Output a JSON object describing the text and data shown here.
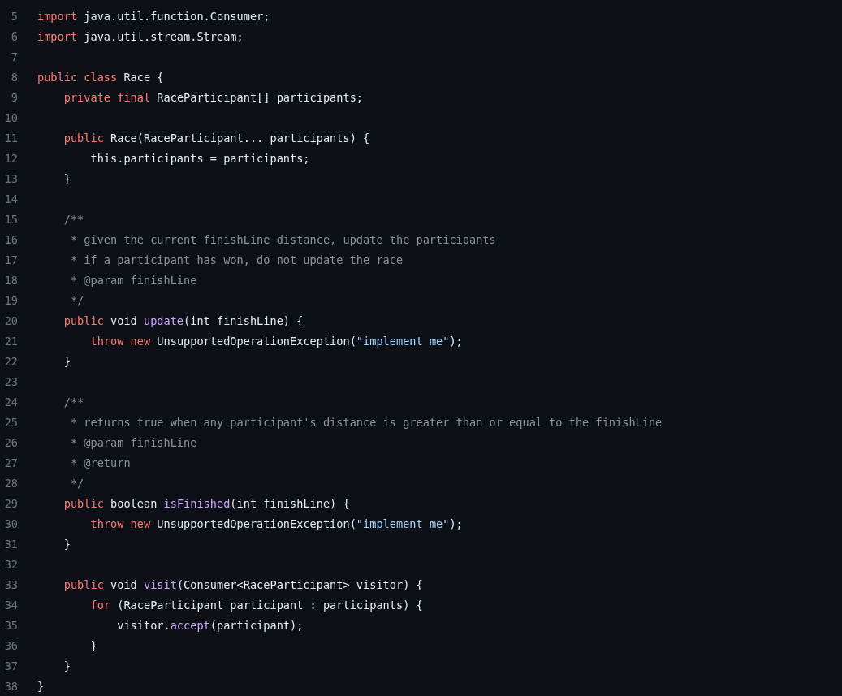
{
  "code_lines": [
    {
      "number": "5",
      "tokens": [
        {
          "kind": "keyword",
          "text": "import"
        },
        {
          "kind": "plain",
          "text": " java.util.function.Consumer;"
        }
      ]
    },
    {
      "number": "6",
      "tokens": [
        {
          "kind": "keyword",
          "text": "import"
        },
        {
          "kind": "plain",
          "text": " java.util.stream.Stream;"
        }
      ]
    },
    {
      "number": "7"
    },
    {
      "number": "8",
      "tokens": [
        {
          "kind": "keyword",
          "text": "public class"
        },
        {
          "kind": "plain",
          "text": " Race {"
        }
      ]
    },
    {
      "number": "9",
      "tokens": [
        {
          "kind": "keyword",
          "text": "    private final"
        },
        {
          "kind": "plain",
          "text": " RaceParticipant[] participants;"
        }
      ]
    },
    {
      "number": "10"
    },
    {
      "number": "11",
      "tokens": [
        {
          "kind": "keyword",
          "text": "    public"
        },
        {
          "kind": "plain",
          "text": " Race(RaceParticipant... participants) {"
        }
      ]
    },
    {
      "number": "12",
      "tokens": [
        {
          "kind": "plain",
          "text": "        this.participants = participants;"
        }
      ]
    },
    {
      "number": "13",
      "tokens": [
        {
          "kind": "plain",
          "text": "    }"
        }
      ]
    },
    {
      "number": "14"
    },
    {
      "number": "15",
      "tokens": [
        {
          "kind": "comment",
          "text": "    /**"
        }
      ]
    },
    {
      "number": "16",
      "tokens": [
        {
          "kind": "comment",
          "text": "     * given the current finishLine distance, update the participants"
        }
      ]
    },
    {
      "number": "17",
      "tokens": [
        {
          "kind": "comment",
          "text": "     * if a participant has won, do not update the race"
        }
      ]
    },
    {
      "number": "18",
      "tokens": [
        {
          "kind": "comment",
          "text": "     * @param finishLine"
        }
      ]
    },
    {
      "number": "19",
      "tokens": [
        {
          "kind": "comment",
          "text": "     */"
        }
      ]
    },
    {
      "number": "20",
      "tokens": [
        {
          "kind": "keyword",
          "text": "    public"
        },
        {
          "kind": "plain",
          "text": " void "
        },
        {
          "kind": "function",
          "text": "update"
        },
        {
          "kind": "plain",
          "text": "(int finishLine) {"
        }
      ]
    },
    {
      "number": "21",
      "tokens": [
        {
          "kind": "keyword",
          "text": "        throw new"
        },
        {
          "kind": "plain",
          "text": " UnsupportedOperationException("
        },
        {
          "kind": "string",
          "text": "\"implement me\""
        },
        {
          "kind": "plain",
          "text": ");"
        }
      ]
    },
    {
      "number": "22",
      "tokens": [
        {
          "kind": "plain",
          "text": "    }"
        }
      ]
    },
    {
      "number": "23"
    },
    {
      "number": "24",
      "tokens": [
        {
          "kind": "comment",
          "text": "    /**"
        }
      ]
    },
    {
      "number": "25",
      "tokens": [
        {
          "kind": "comment",
          "text": "     * returns true when any participant's distance is greater than or equal to the finishLine"
        }
      ]
    },
    {
      "number": "26",
      "tokens": [
        {
          "kind": "comment",
          "text": "     * @param finishLine"
        }
      ]
    },
    {
      "number": "27",
      "tokens": [
        {
          "kind": "comment",
          "text": "     * @return"
        }
      ]
    },
    {
      "number": "28",
      "tokens": [
        {
          "kind": "comment",
          "text": "     */"
        }
      ]
    },
    {
      "number": "29",
      "tokens": [
        {
          "kind": "keyword",
          "text": "    public"
        },
        {
          "kind": "plain",
          "text": " boolean "
        },
        {
          "kind": "function",
          "text": "isFinished"
        },
        {
          "kind": "plain",
          "text": "(int finishLine) {"
        }
      ]
    },
    {
      "number": "30",
      "tokens": [
        {
          "kind": "keyword",
          "text": "        throw new"
        },
        {
          "kind": "plain",
          "text": " UnsupportedOperationException("
        },
        {
          "kind": "string",
          "text": "\"implement me\""
        },
        {
          "kind": "plain",
          "text": ");"
        }
      ]
    },
    {
      "number": "31",
      "tokens": [
        {
          "kind": "plain",
          "text": "    }"
        }
      ]
    },
    {
      "number": "32"
    },
    {
      "number": "33",
      "tokens": [
        {
          "kind": "keyword",
          "text": "    public"
        },
        {
          "kind": "plain",
          "text": " void "
        },
        {
          "kind": "function",
          "text": "visit"
        },
        {
          "kind": "plain",
          "text": "(Consumer<RaceParticipant> visitor) {"
        }
      ]
    },
    {
      "number": "34",
      "tokens": [
        {
          "kind": "keyword",
          "text": "        for"
        },
        {
          "kind": "plain",
          "text": " (RaceParticipant participant : participants) {"
        }
      ]
    },
    {
      "number": "35",
      "tokens": [
        {
          "kind": "plain",
          "text": "            visitor."
        },
        {
          "kind": "function",
          "text": "accept"
        },
        {
          "kind": "plain",
          "text": "(participant);"
        }
      ]
    },
    {
      "number": "36",
      "tokens": [
        {
          "kind": "plain",
          "text": "        }"
        }
      ]
    },
    {
      "number": "37",
      "tokens": [
        {
          "kind": "plain",
          "text": "    }"
        }
      ]
    },
    {
      "number": "38",
      "tokens": [
        {
          "kind": "plain",
          "text": "}"
        }
      ]
    }
  ]
}
